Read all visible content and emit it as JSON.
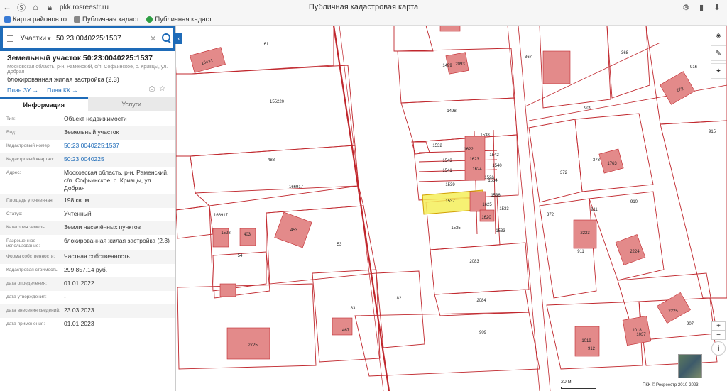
{
  "browser": {
    "url": "pkk.rosreestr.ru",
    "window_title": "Публичная кадастровая карта",
    "bookmarks": [
      {
        "label": "Карта районов го",
        "color": "#3a7bd5"
      },
      {
        "label": "Публичная кадаст",
        "color": "#888888"
      },
      {
        "label": "Публичная кадаст",
        "color": "#2e9e44"
      }
    ]
  },
  "search": {
    "type": "Участки",
    "query": "50:23:0040225:1537"
  },
  "object": {
    "title": "Земельный участок 50:23:0040225:1537",
    "address": "Московская область, р-н. Раменский, с/п. Софьинское, с. Кривцы, ул. Добрая",
    "use": "блокированная жилая застройка (2.3)",
    "link_plan_zu": "План ЗУ →",
    "link_plan_kk": "План КК →"
  },
  "tabs": [
    {
      "label": "Информация",
      "active": true
    },
    {
      "label": "Услуги",
      "active": false
    }
  ],
  "properties": [
    {
      "label": "Тип:",
      "value": "Объект недвижимости"
    },
    {
      "label": "Вид:",
      "value": "Земельный участок"
    },
    {
      "label": "Кадастровый номер:",
      "value": "50:23:0040225:1537",
      "link": true
    },
    {
      "label": "Кадастровый квартал:",
      "value": "50:23:0040225",
      "link": true
    },
    {
      "label": "Адрес:",
      "value": "Московская область, р-н. Раменский, с/п. Софьинское, с. Кривцы, ул. Добрая"
    },
    {
      "label": "Площадь уточненная:",
      "value": "198 кв. м"
    },
    {
      "label": "Статус:",
      "value": "Учтенный"
    },
    {
      "label": "Категория земель:",
      "value": "Земли населённых пунктов"
    },
    {
      "label": "Разрешенное использование:",
      "value": "блокированная жилая застройка (2.3)"
    },
    {
      "label": "Форма собственности:",
      "value": "Частная собственность"
    },
    {
      "label": "Кадастровая стоимость:",
      "value": "299 857,14 руб."
    },
    {
      "label": "дата определения:",
      "value": "01.01.2022"
    },
    {
      "label": "дата утверждения:",
      "value": "-"
    },
    {
      "label": "дата внесения сведений:",
      "value": "23.03.2023"
    },
    {
      "label": "дата применения:",
      "value": "01.01.2023"
    }
  ],
  "map": {
    "parcel_labels": [
      "61",
      "155220",
      "488",
      "166917",
      "166917",
      "54",
      "53",
      "83",
      "82",
      "1499",
      "1498",
      "1532",
      "1543",
      "1541",
      "1539",
      "1537",
      "1535",
      "2083",
      "2084",
      "909",
      "1538",
      "1542",
      "1540",
      "1534",
      "1536",
      "1533",
      "1533",
      "367",
      "368",
      "372",
      "373",
      "911",
      "910",
      "911",
      "916",
      "915",
      "909",
      "907",
      "372"
    ],
    "building_labels": [
      "16431",
      "2093",
      "1622",
      "1623",
      "1624",
      "1625",
      "1620",
      "1526",
      "1528",
      "403",
      "453",
      "467",
      "2725",
      "272",
      "1763",
      "2223",
      "2224",
      "2225",
      "1018",
      "1037",
      "1019",
      "912"
    ],
    "scale_label": "20 м",
    "copyright": "ПКК © Росреестр 2010-2023"
  },
  "colors": {
    "accent": "#1e6bb8",
    "parcel_line": "#c0272d",
    "building_fill": "#e38a8a",
    "selected_fill": "#f5ee5a"
  }
}
